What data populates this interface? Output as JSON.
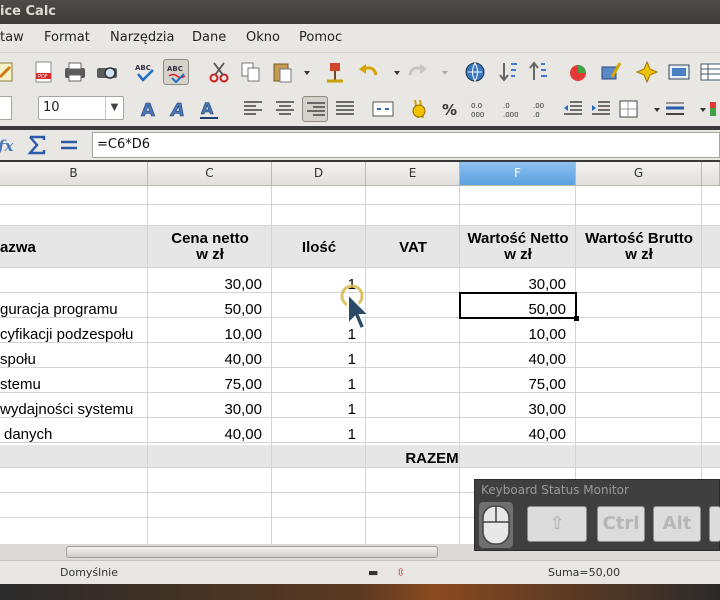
{
  "window": {
    "title": "ice Calc"
  },
  "menu": [
    "taw",
    "Format",
    "Narzędzia",
    "Dane",
    "Okno",
    "Pomoc"
  ],
  "font_size": "10",
  "formula": "=C6*D6",
  "columns": [
    "B",
    "C",
    "D",
    "E",
    "F",
    "G"
  ],
  "selected_column": "F",
  "headers": {
    "b": "azwa",
    "c": "Cena netto\nw zł",
    "d": "Ilość",
    "e": "VAT",
    "f": "Wartość Netto\nw zł",
    "g": "Wartość Brutto\nw zł"
  },
  "rows": [
    {
      "name": "",
      "price": "30,00",
      "qty": "1",
      "net": "30,00"
    },
    {
      "name": "guracja programu",
      "price": "50,00",
      "qty": "",
      "net": "50,00"
    },
    {
      "name": "cyfikacji podzespołu",
      "price": "10,00",
      "qty": "1",
      "net": "10,00"
    },
    {
      "name": "społu",
      "price": "40,00",
      "qty": "1",
      "net": "40,00"
    },
    {
      "name": "stemu",
      "price": "75,00",
      "qty": "1",
      "net": "75,00"
    },
    {
      "name": "wydajności systemu",
      "price": "30,00",
      "qty": "1",
      "net": "30,00"
    },
    {
      "name": "danych",
      "price": "40,00",
      "qty": "1",
      "net": "40,00"
    }
  ],
  "total_label": "RAZEM",
  "status": {
    "style": "Domyślnie",
    "sum": "Suma=50,00"
  },
  "keyboard_monitor": {
    "title": "Keyboard Status Monitor",
    "keys": [
      "⇧",
      "Ctrl",
      "Alt"
    ]
  }
}
